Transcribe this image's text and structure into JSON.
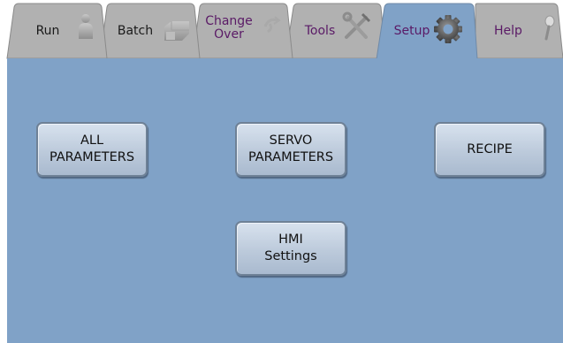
{
  "tabs": [
    {
      "label": "Run",
      "icon": "person-icon"
    },
    {
      "label": "Batch",
      "icon": "batch-icon"
    },
    {
      "label": "Change\nOver",
      "icon": "changeover-icon"
    },
    {
      "label": "Tools",
      "icon": "tools-icon"
    },
    {
      "label": "Setup",
      "icon": "gear-icon"
    },
    {
      "label": "Help",
      "icon": "help-icon"
    }
  ],
  "active_tab": "Setup",
  "buttons": {
    "all_parameters": "ALL\nPARAMETERS",
    "servo_parameters": "SERVO\nPARAMETERS",
    "recipe": "RECIPE",
    "hmi_settings": "HMI\nSettings"
  },
  "colors": {
    "panel": "#80a2c7",
    "inactive_tab": "#b1b1b1",
    "active_tab": "#80a2c7",
    "active_label": "#5a1a66"
  }
}
